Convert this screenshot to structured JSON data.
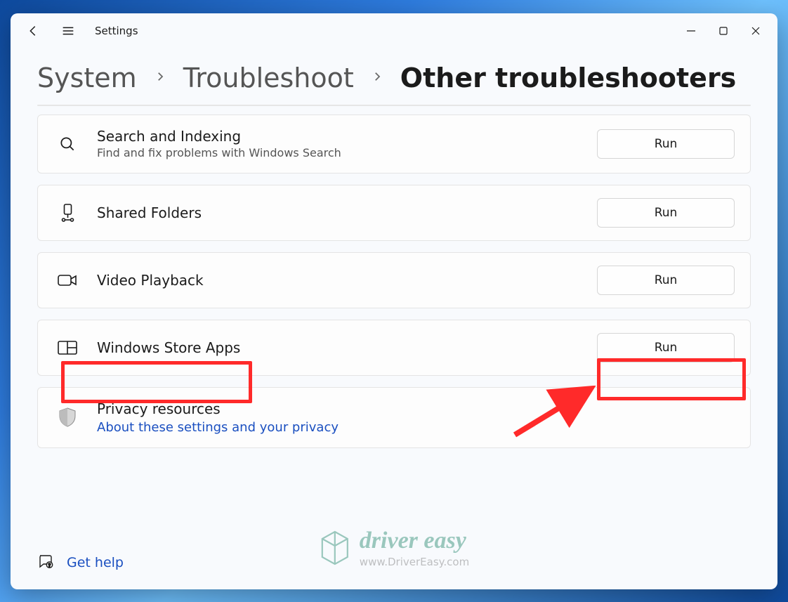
{
  "app": {
    "title": "Settings"
  },
  "breadcrumb": {
    "a": "System",
    "b": "Troubleshoot",
    "c": "Other troubleshooters"
  },
  "items": [
    {
      "title": "Search and Indexing",
      "desc": "Find and fix problems with Windows Search",
      "run": "Run"
    },
    {
      "title": "Shared Folders",
      "desc": "",
      "run": "Run"
    },
    {
      "title": "Video Playback",
      "desc": "",
      "run": "Run"
    },
    {
      "title": "Windows Store Apps",
      "desc": "",
      "run": "Run"
    }
  ],
  "privacy": {
    "title": "Privacy resources",
    "link": "About these settings and your privacy"
  },
  "help": {
    "label": "Get help"
  },
  "watermark": {
    "brand": "driver easy",
    "url": "www.DriverEasy.com"
  }
}
